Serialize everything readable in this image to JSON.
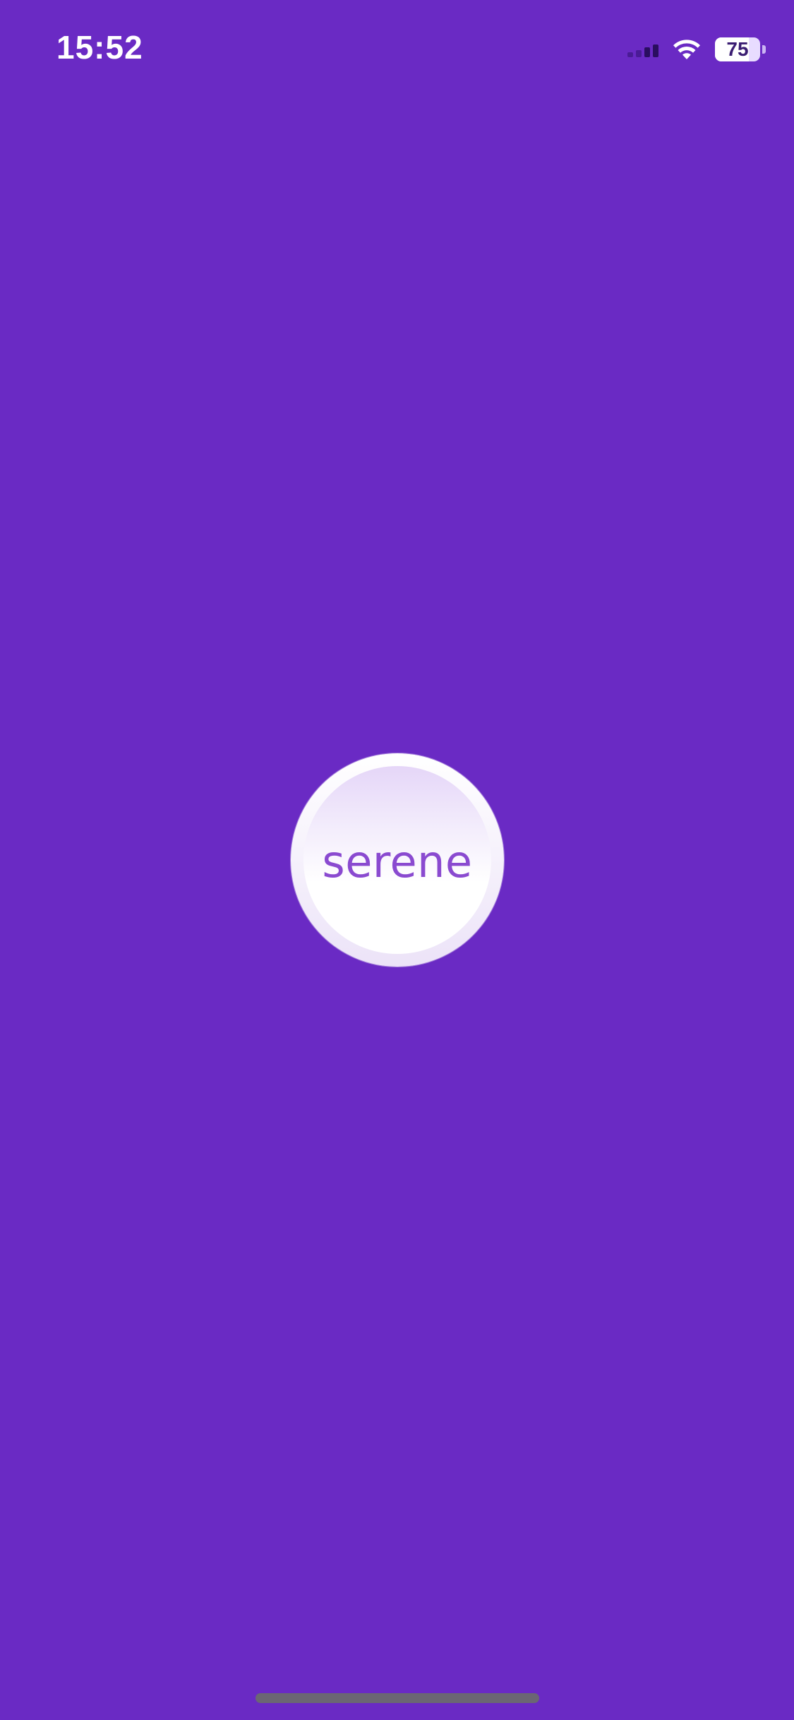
{
  "status_bar": {
    "time": "15:52",
    "battery_level": "75",
    "battery_fraction": 0.75,
    "icons": {
      "signal": "cellular-signal-icon",
      "wifi": "wifi-icon",
      "battery": "battery-icon"
    }
  },
  "splash": {
    "logo_text": "serene"
  },
  "colors": {
    "background": "#6a2ac4",
    "logo_text": "#8a4ad0",
    "logo_circle_top": "#e5d6f8",
    "logo_circle_bottom": "#ffffff",
    "home_indicator": "#6b6673"
  }
}
